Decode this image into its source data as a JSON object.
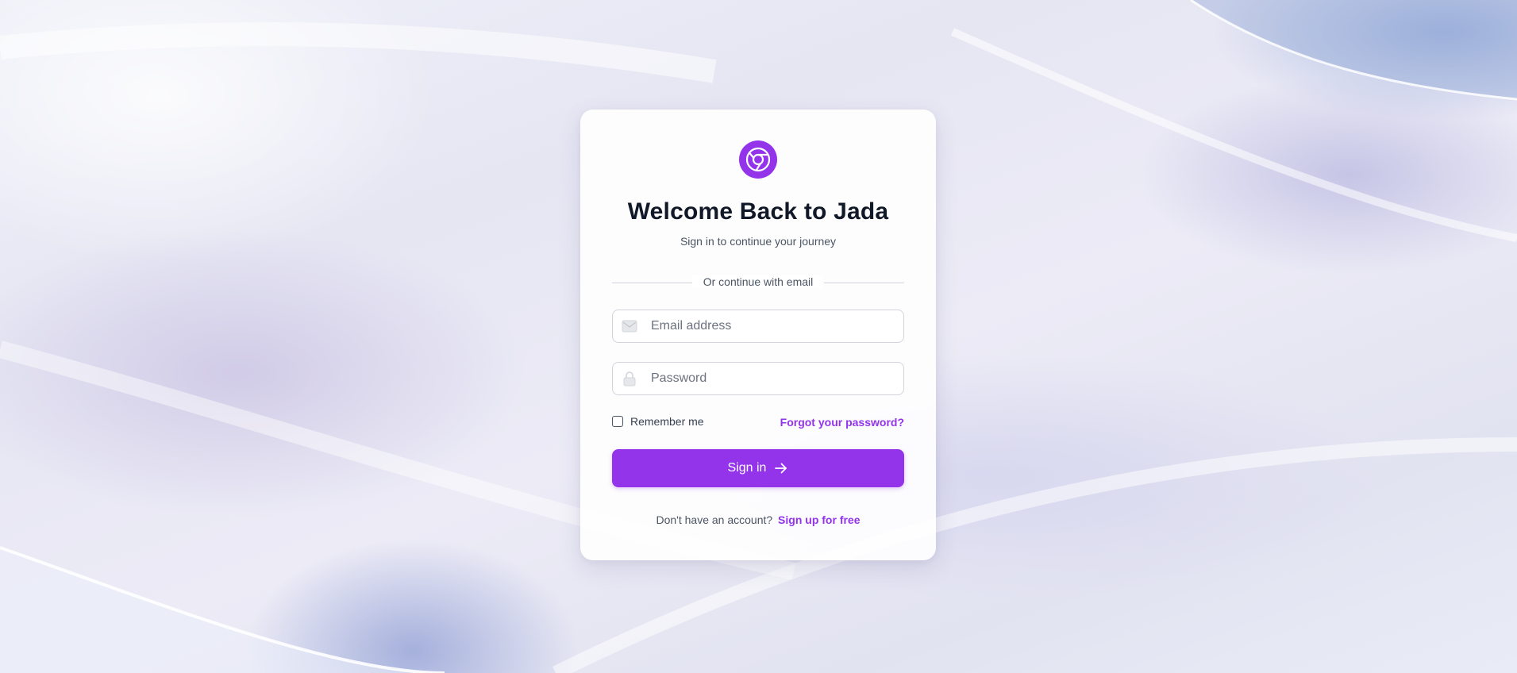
{
  "brand": {
    "logo_icon": "chrome-style-logo-icon",
    "accent_color": "#9333ea"
  },
  "header": {
    "title": "Welcome Back to Jada",
    "subtitle": "Sign in to continue your journey"
  },
  "divider": {
    "label": "Or continue with email"
  },
  "form": {
    "email": {
      "icon": "mail-icon",
      "placeholder": "Email address",
      "value": ""
    },
    "password": {
      "icon": "lock-icon",
      "placeholder": "Password",
      "value": ""
    },
    "remember_me": {
      "label": "Remember me",
      "checked": false
    },
    "forgot_password_label": "Forgot your password?",
    "submit": {
      "label": "Sign in",
      "icon": "arrow-right-icon"
    }
  },
  "footer": {
    "prompt": "Don't have an account?",
    "signup_label": "Sign up for free"
  }
}
